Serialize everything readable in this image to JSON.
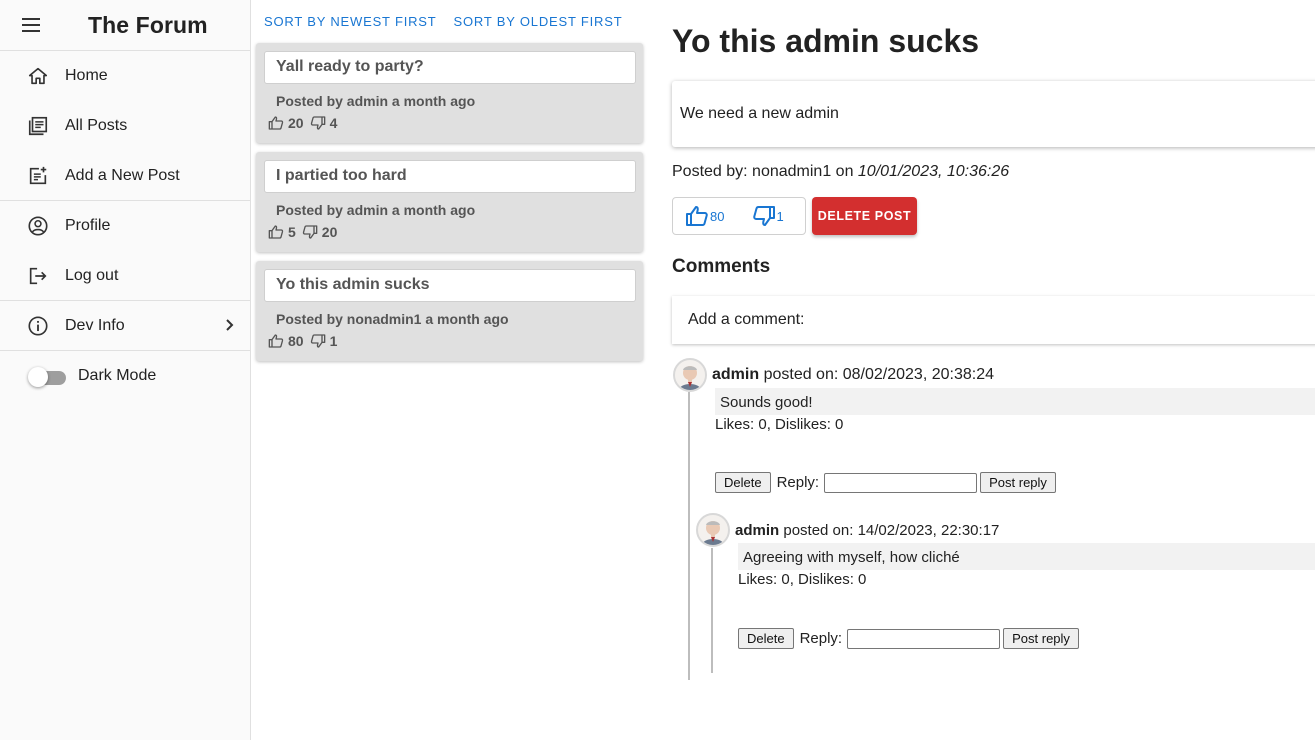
{
  "app": {
    "title": "The Forum"
  },
  "sidebar": {
    "items": [
      {
        "label": "Home",
        "icon": "home-icon"
      },
      {
        "label": "All Posts",
        "icon": "list-icon"
      },
      {
        "label": "Add a New Post",
        "icon": "add-post-icon"
      },
      {
        "label": "Profile",
        "icon": "account-circle-icon"
      },
      {
        "label": "Log out",
        "icon": "logout-icon"
      },
      {
        "label": "Dev Info",
        "icon": "info-icon"
      }
    ],
    "dark_mode_label": "Dark Mode",
    "dark_mode_on": false
  },
  "sort": {
    "newest": "SORT BY NEWEST FIRST",
    "oldest": "SORT BY OLDEST FIRST"
  },
  "posts": [
    {
      "title": "Yall ready to party?",
      "meta": "Posted by admin a month ago",
      "likes": "20",
      "dislikes": "4"
    },
    {
      "title": "I partied too hard",
      "meta": "Posted by admin a month ago",
      "likes": "5",
      "dislikes": "20"
    },
    {
      "title": "Yo this admin sucks",
      "meta": "Posted by nonadmin1 a month ago",
      "likes": "80",
      "dislikes": "1"
    }
  ],
  "current_post": {
    "title": "Yo this admin sucks",
    "body": "We need a new admin",
    "posted_prefix": "Posted by: nonadmin1 on ",
    "posted_date": "10/01/2023, 10:36:26",
    "likes": "80",
    "dislikes": "1",
    "delete_label": "DELETE POST",
    "comments_heading": "Comments",
    "add_comment_label": "Add a comment:"
  },
  "comments": [
    {
      "author": "admin",
      "posted": " posted on: 08/02/2023, 20:38:24",
      "body": "Sounds good!",
      "likes": "Likes: 0, Dislikes: 0",
      "delete_label": "Delete",
      "reply_label": "Reply:",
      "post_reply_label": "Post reply"
    },
    {
      "author": "admin",
      "posted": " posted on: 14/02/2023, 22:30:17",
      "body": "Agreeing with myself, how cliché",
      "likes": "Likes: 0, Dislikes: 0",
      "delete_label": "Delete",
      "reply_label": "Reply:",
      "post_reply_label": "Post reply"
    }
  ],
  "colors": {
    "primary": "#1976d2",
    "danger": "#d32f2f",
    "card_bg": "#e0e0e0"
  }
}
